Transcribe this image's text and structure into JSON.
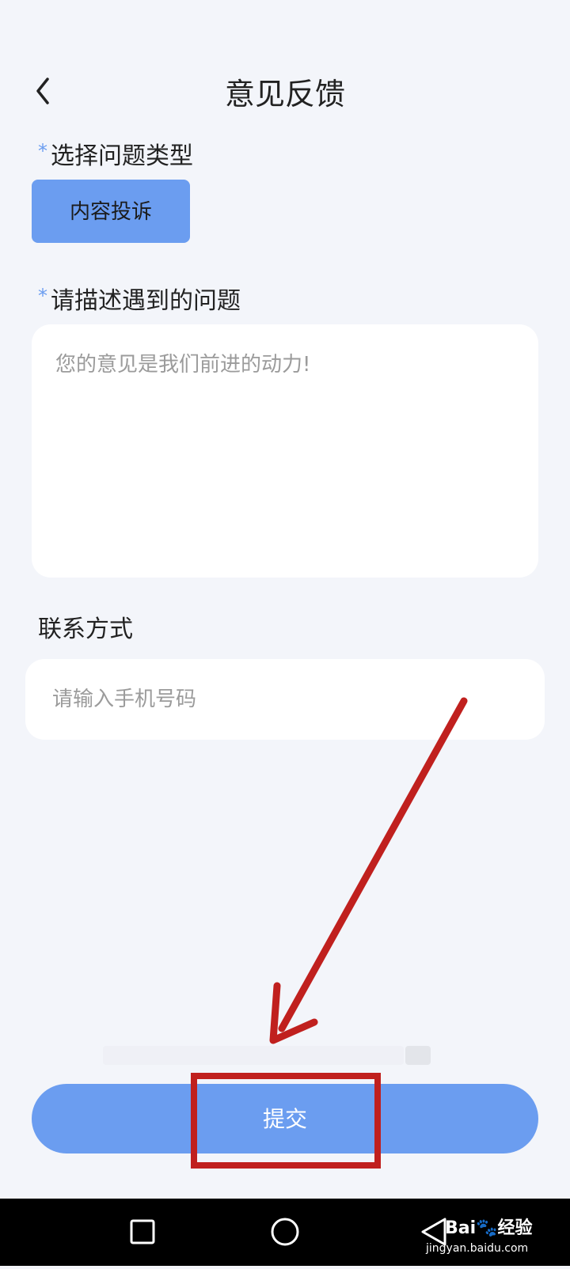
{
  "header": {
    "back_icon": "chevron-left-icon",
    "title": "意见反馈"
  },
  "issue_type": {
    "required_mark": "*",
    "label": "选择问题类型",
    "selected_option": "内容投诉"
  },
  "description": {
    "required_mark": "*",
    "label": "请描述遇到的问题",
    "placeholder": "您的意见是我们前进的动力!",
    "value": ""
  },
  "contact": {
    "label": "联系方式",
    "placeholder": "请输入手机号码",
    "value": ""
  },
  "submit": {
    "label": "提交"
  },
  "nav_bar": {
    "items": [
      "recents-square-icon",
      "home-circle-icon",
      "back-triangle-icon"
    ]
  },
  "watermark": {
    "main": "Bai🐾经验",
    "sub": "jingyan.baidu.com"
  },
  "colors": {
    "background": "#f3f5fa",
    "accent": "#6b9df0",
    "annotation_red": "#c0201e",
    "nav_bar": "#000000"
  }
}
